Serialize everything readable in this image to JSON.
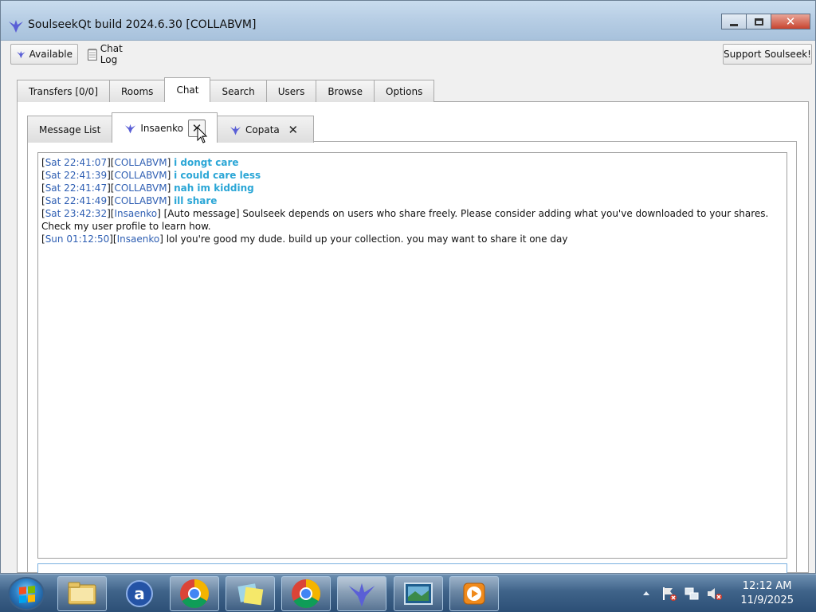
{
  "window": {
    "title": "SoulseekQt build 2024.6.30 [COLLABVM]"
  },
  "toolbar": {
    "available_label": "Available",
    "chatlog_label": "Chat Log",
    "support_label": "Support Soulseek!"
  },
  "main_tabs": [
    "Transfers [0/0]",
    "Rooms",
    "Chat",
    "Search",
    "Users",
    "Browse",
    "Options"
  ],
  "main_tab_active": "Chat",
  "sub_tabs": {
    "message_list": "Message List",
    "insaenko": "Insaenko",
    "copata": "Copata"
  },
  "messages": [
    {
      "time": "Sat 22:41:07",
      "user": "COLLABVM",
      "text": "i dongt care",
      "self": true
    },
    {
      "time": "Sat 22:41:39",
      "user": "COLLABVM",
      "text": "i could care less",
      "self": true
    },
    {
      "time": "Sat 22:41:47",
      "user": "COLLABVM",
      "text": "nah im kidding",
      "self": true
    },
    {
      "time": "Sat 22:41:49",
      "user": "COLLABVM",
      "text": "ill share",
      "self": true
    },
    {
      "time": "Sat 23:42:32",
      "user": "Insaenko",
      "text": "[Auto message] Soulseek depends on users who share freely. Please consider adding what you've downloaded to your shares. Check my user profile to learn how.",
      "self": false
    },
    {
      "time": "Sun 01:12:50",
      "user": "Insaenko",
      "text": "lol you're good my dude. build up your collection. you may want to share it one day",
      "self": false
    }
  ],
  "taskbar": {
    "icons": [
      "explorer-icon",
      "avast-icon",
      "chrome-icon",
      "sticky-notes-icon",
      "chrome-icon",
      "soulseek-icon",
      "media-center-icon",
      "media-player-icon"
    ],
    "time": "12:12 AM",
    "date": "11/9/2025"
  },
  "colors": {
    "timestamp": "#2f5fb3",
    "self_message": "#2aa6d6",
    "titlebar": "#b6cde4",
    "taskbar": "#3f6389"
  }
}
